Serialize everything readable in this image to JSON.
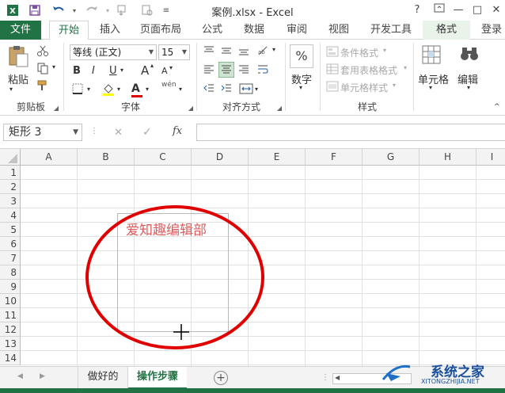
{
  "window": {
    "title": "案例.xlsx - Excel",
    "help": "?",
    "minimize": "—",
    "maximize": "□",
    "close": "✕"
  },
  "quick_access": {
    "save_icon": "save-icon",
    "undo_icon": "undo-icon",
    "redo_icon": "redo-icon"
  },
  "tabs": {
    "file": "文件",
    "home": "开始",
    "insert": "插入",
    "page_layout": "页面布局",
    "formulas": "公式",
    "data": "数据",
    "review": "审阅",
    "view": "视图",
    "developer": "开发工具",
    "format": "格式",
    "login": "登录"
  },
  "ribbon": {
    "clipboard": {
      "paste": "粘贴",
      "label": "剪贴板"
    },
    "font": {
      "name": "等线 (正文)",
      "size": "15",
      "bold": "B",
      "italic": "I",
      "underline": "U",
      "font_color_glyph": "A",
      "grow": "A",
      "shrink": "A",
      "wen": "wén",
      "label": "字体"
    },
    "alignment": {
      "label": "对齐方式"
    },
    "number": {
      "percent": "%",
      "label": "数字"
    },
    "styles": {
      "conditional": "条件格式",
      "table": "套用表格格式",
      "cell_styles": "单元格样式",
      "label": "样式"
    },
    "cells": {
      "label": "单元格"
    },
    "editing": {
      "label": "编辑"
    }
  },
  "formula_bar": {
    "name_box": "矩形 3",
    "cancel": "✕",
    "enter": "✓",
    "fx": "fx",
    "value": ""
  },
  "columns": [
    "A",
    "B",
    "C",
    "D",
    "E",
    "F",
    "G",
    "H",
    "I"
  ],
  "rows": [
    "1",
    "2",
    "3",
    "4",
    "5",
    "6",
    "7",
    "8",
    "9",
    "10",
    "11",
    "12",
    "13",
    "14"
  ],
  "shape": {
    "text": "爱知趣编辑部",
    "circle_color": "#e00000",
    "text_color": "#e05a5a"
  },
  "sheets": {
    "tab1": "做好的",
    "tab2": "操作步骤",
    "add": "+"
  },
  "watermark": {
    "text": "系统之家",
    "url": "XITONGZHIJIA.NET"
  },
  "colors": {
    "accent": "#217346"
  }
}
